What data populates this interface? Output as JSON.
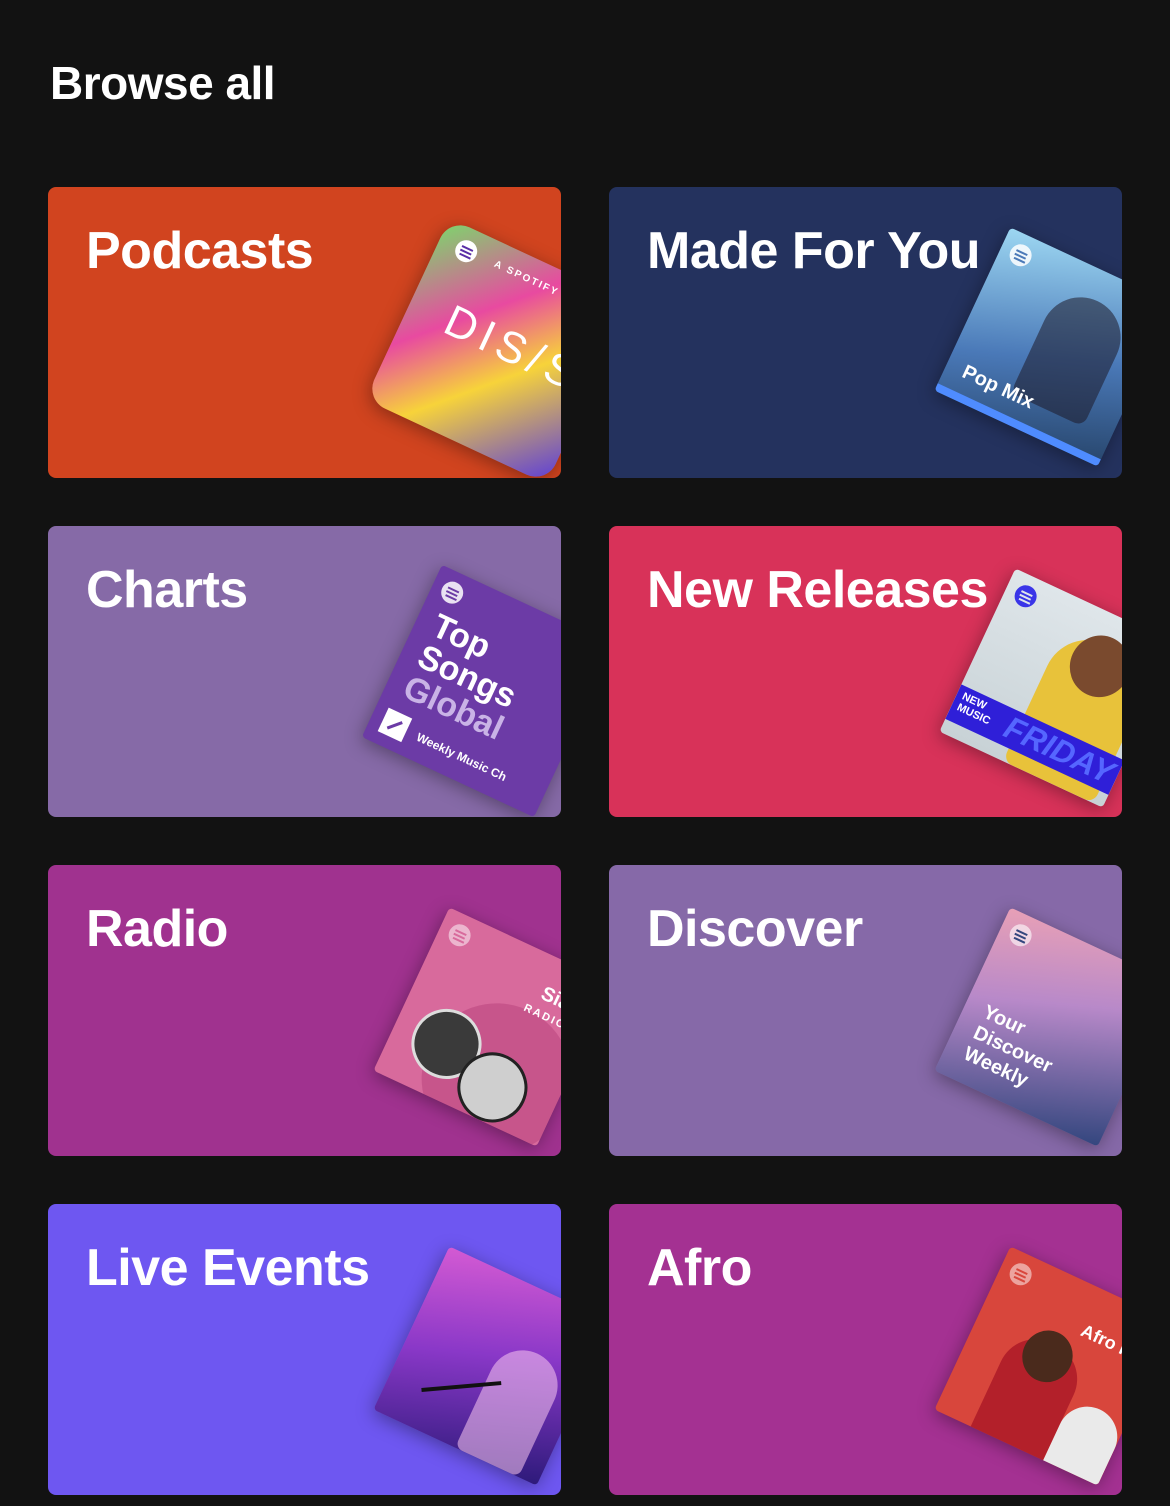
{
  "header": {
    "title": "Browse all"
  },
  "tiles": [
    {
      "label": "Podcasts",
      "color": "#d1441f",
      "cover": {
        "line1": "A SPOTIFY O",
        "line2": "DIS/SEC"
      }
    },
    {
      "label": "Made For You",
      "color": "#24325e",
      "cover": {
        "line1": "Pop Mix"
      }
    },
    {
      "label": "Charts",
      "color": "#866aa7",
      "cover": {
        "line1": "Top",
        "line2": "Songs",
        "line3": "Global",
        "line4": "Weekly Music Ch"
      }
    },
    {
      "label": "New Releases",
      "color": "#d83259",
      "cover": {
        "line1": "NEW MUSIC",
        "line2": "FRIDAY"
      }
    },
    {
      "label": "Radio",
      "color": "#a0328f",
      "cover": {
        "line1": "Sia",
        "line2": "RADIO"
      }
    },
    {
      "label": "Discover",
      "color": "#8669a8",
      "cover": {
        "line1": "Your",
        "line2": "Discover",
        "line3": "Weekly"
      }
    },
    {
      "label": "Live Events",
      "color": "#6e57f1",
      "cover": {}
    },
    {
      "label": "Afro",
      "color": "#a43192",
      "cover": {
        "line1": "Afro Hi"
      }
    }
  ]
}
